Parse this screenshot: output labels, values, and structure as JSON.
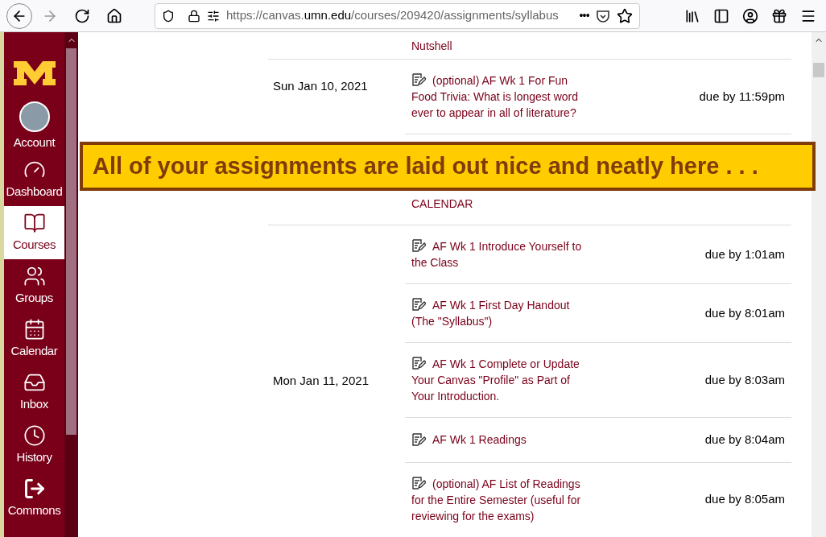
{
  "browser": {
    "url_scheme": "https://canvas.",
    "url_domain": "umn.edu",
    "url_path": "/courses/209420/assignments/syllabus",
    "more": "•••"
  },
  "sidebar": {
    "items": [
      {
        "kind": "account",
        "label": "Account",
        "selected": false
      },
      {
        "kind": "dashboard",
        "label": "Dashboard",
        "selected": false
      },
      {
        "kind": "courses",
        "label": "Courses",
        "selected": true
      },
      {
        "kind": "groups",
        "label": "Groups",
        "selected": false
      },
      {
        "kind": "calendar",
        "label": "Calendar",
        "selected": false
      },
      {
        "kind": "inbox",
        "label": "Inbox",
        "selected": false
      },
      {
        "kind": "history",
        "label": "History",
        "selected": false
      },
      {
        "kind": "commons",
        "label": "Commons",
        "selected": false
      }
    ]
  },
  "syllabus": {
    "groups": [
      {
        "items": [
          {
            "title": "Nutshell",
            "icon": false
          }
        ]
      },
      {
        "date": "Sun Jan 10, 2021",
        "items": [
          {
            "title": "(optional) AF Wk 1 For Fun Food Trivia: What is longest word ever to appear in all of literature?",
            "due": "due by 11:59pm",
            "icon": true
          },
          {
            "title": "CALENDAR",
            "icon": false
          }
        ]
      },
      {
        "date": "Mon Jan 11, 2021",
        "items": [
          {
            "title": "AF Wk 1 Introduce Yourself to the Class",
            "due": "due by 1:01am",
            "icon": true
          },
          {
            "title": "AF Wk 1 First Day Handout (The \"Syllabus\")",
            "due": "due by 8:01am",
            "icon": true
          },
          {
            "title": "AF Wk 1 Complete or Update Your Canvas \"Profile\" as Part of Your Introduction.",
            "due": "due by 8:03am",
            "icon": true
          },
          {
            "title": "AF Wk 1 Readings",
            "due": "due by 8:04am",
            "icon": true
          },
          {
            "title": "(optional) AF List of Readings for the Entire Semester (useful for reviewing for the exams)",
            "due": "due by 8:05am",
            "icon": true
          }
        ]
      }
    ]
  },
  "callout": {
    "text": "All of your assignments are laid out nice and neatly here . . ."
  }
}
